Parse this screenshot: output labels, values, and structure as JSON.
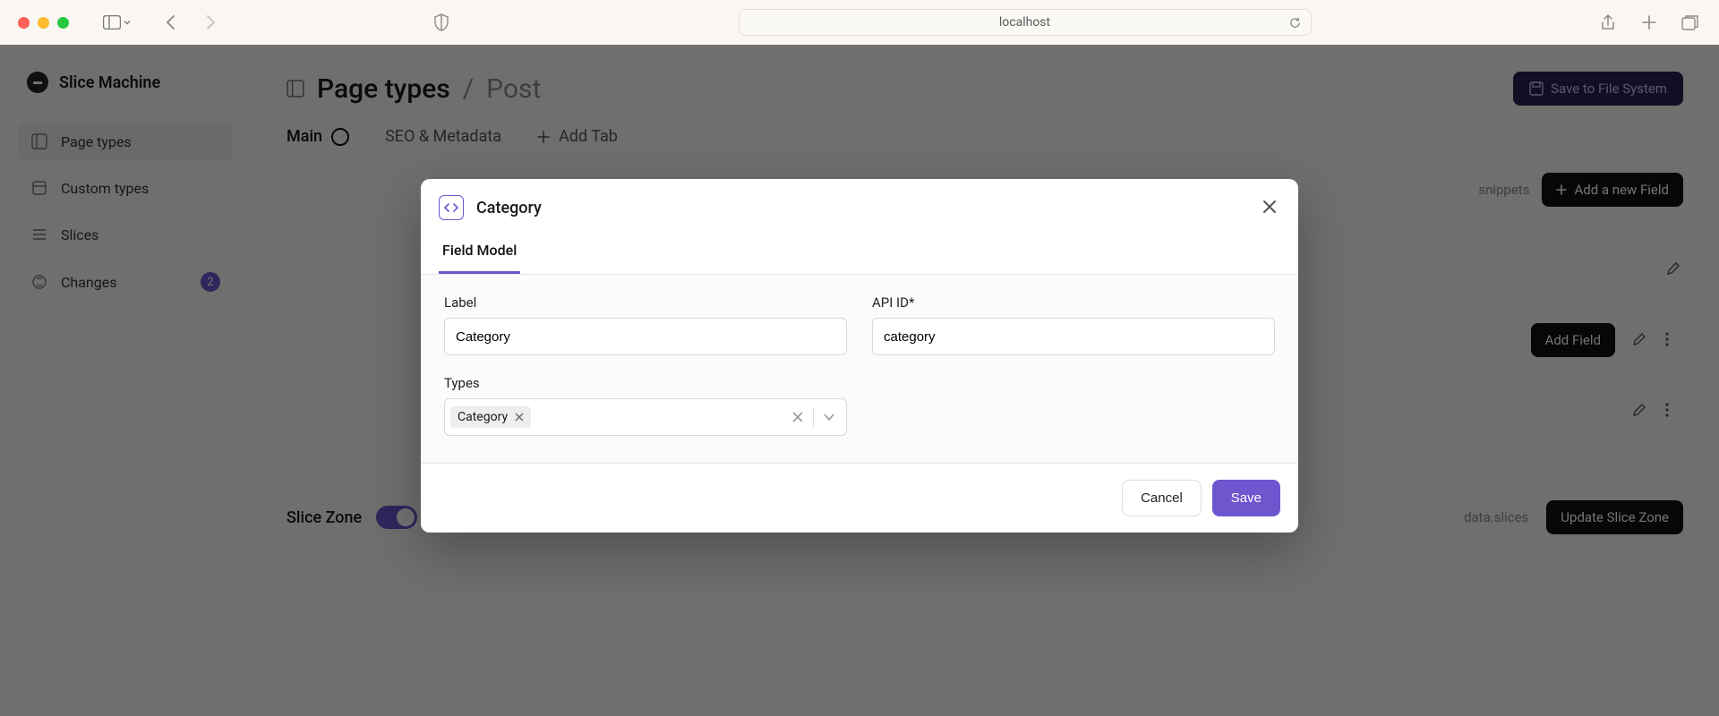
{
  "browser": {
    "url": "localhost"
  },
  "app": {
    "brand": "Slice Machine",
    "nav": {
      "page_types": "Page types",
      "custom_types": "Custom types",
      "slices": "Slices",
      "changes": "Changes",
      "changes_badge": "2"
    },
    "header": {
      "crumb_root": "Page types",
      "crumb_leaf": "Post",
      "save_button": "Save to File System"
    },
    "tabs": {
      "main": "Main",
      "seo": "SEO & Metadata",
      "add": "Add Tab"
    },
    "toolbar": {
      "snippets": "snippets",
      "add_field": "Add a new Field",
      "add_field_group": "Add Field"
    },
    "slice_zone": {
      "label": "Slice Zone",
      "data_label": "data.slices",
      "update_button": "Update Slice Zone"
    }
  },
  "modal": {
    "title": "Category",
    "tab_field_model": "Field Model",
    "fields": {
      "label_label": "Label",
      "label_value": "Category",
      "api_id_label": "API ID*",
      "api_id_value": "category",
      "types_label": "Types",
      "types_selected": [
        "Category"
      ]
    },
    "actions": {
      "cancel": "Cancel",
      "save": "Save"
    }
  }
}
